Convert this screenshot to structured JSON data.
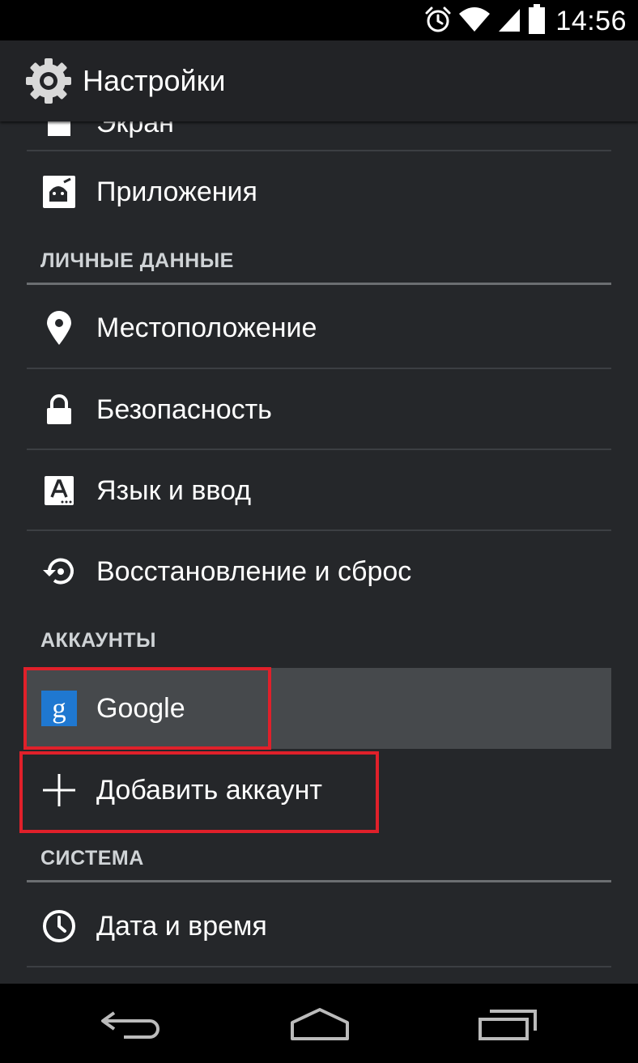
{
  "status_bar": {
    "time": "14:56",
    "icons": [
      "alarm-icon",
      "wifi-icon",
      "signal-icon",
      "battery-icon"
    ]
  },
  "action_bar": {
    "title": "Настройки",
    "icon": "settings-gear-icon"
  },
  "list": {
    "partial_item": {
      "label": "Экран",
      "icon": "display-icon"
    },
    "apps": {
      "label": "Приложения",
      "icon": "apps-icon"
    },
    "sections": {
      "personal": "ЛИЧНЫЕ ДАННЫЕ",
      "accounts": "АККАУНТЫ",
      "system": "СИСТЕМА"
    },
    "personal_items": [
      {
        "label": "Местоположение",
        "icon": "location-pin-icon"
      },
      {
        "label": "Безопасность",
        "icon": "lock-icon"
      },
      {
        "label": "Язык и ввод",
        "icon": "language-icon"
      },
      {
        "label": "Восстановление и сброс",
        "icon": "backup-restore-icon"
      }
    ],
    "account_items": [
      {
        "label": "Google",
        "icon": "google-icon",
        "glyph": "g"
      },
      {
        "label": "Добавить аккаунт",
        "icon": "plus-icon"
      }
    ],
    "system_items": [
      {
        "label": "Дата и время",
        "icon": "clock-icon"
      }
    ]
  },
  "nav_bar": {
    "buttons": [
      "back-icon",
      "home-icon",
      "recents-icon"
    ]
  },
  "colors": {
    "highlight_box": "#e0202a",
    "list_background": "#25272a",
    "selected_row": "#46494c",
    "google_blue": "#1f78d1"
  }
}
